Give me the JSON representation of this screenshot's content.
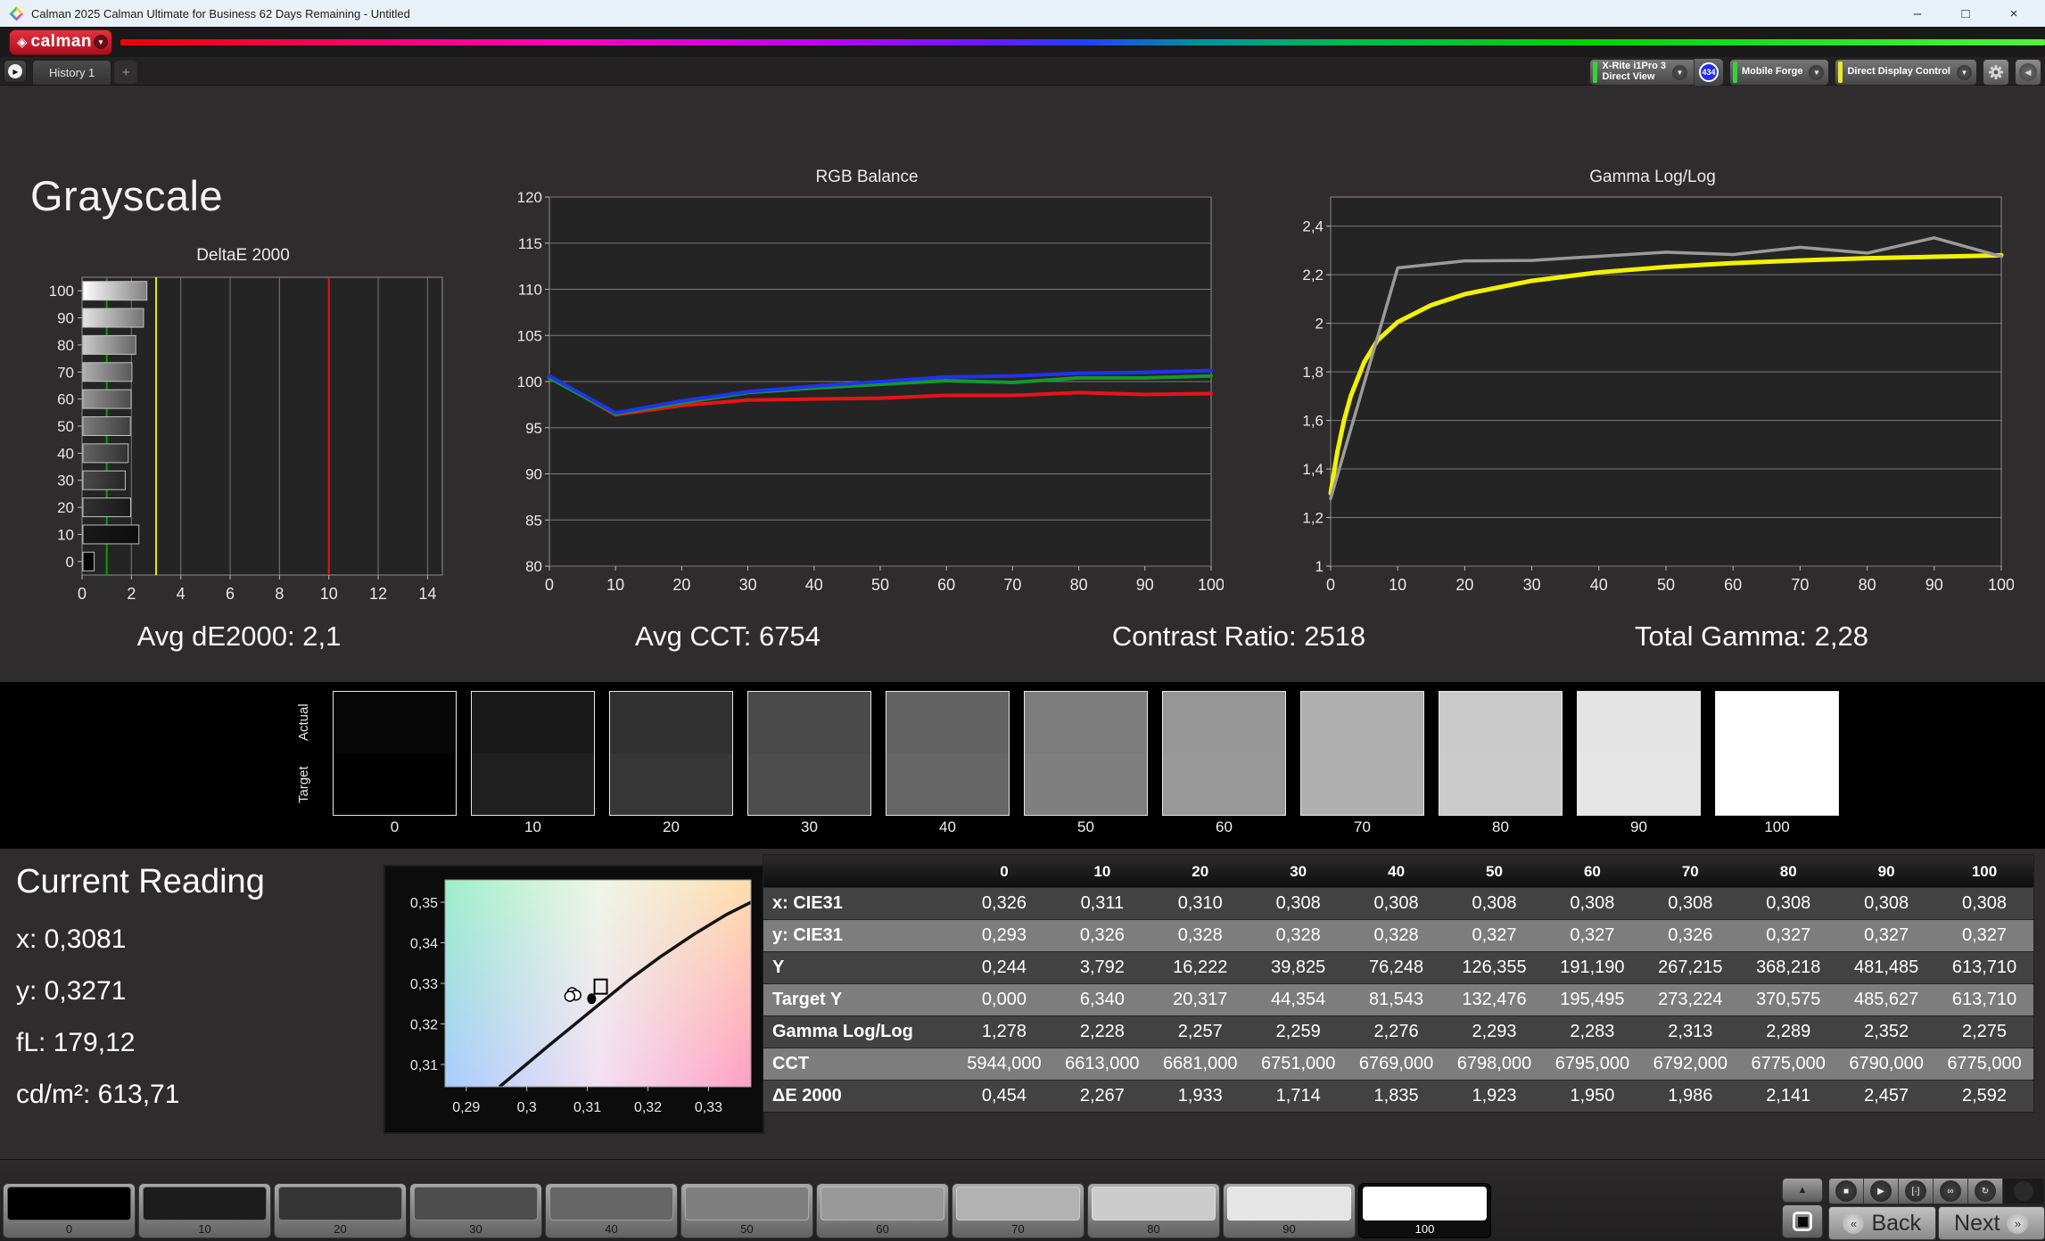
{
  "window": {
    "title": "Calman 2025 Calman Ultimate for Business 62 Days Remaining  - Untitled"
  },
  "icons": {
    "minimize": "–",
    "maximize": "□",
    "close": "×",
    "dropdown_chevron": "▼",
    "panel_arrow": "▶",
    "add_tab": "+",
    "collapse": "◀",
    "brand_diamond": "◈",
    "stop": "■",
    "play": "▶",
    "measure": "[·]",
    "continuous": "∞",
    "refresh": "↻",
    "up": "▲",
    "back_chevron": "«",
    "next_chevron": "»"
  },
  "brand": {
    "name": "calman"
  },
  "tabs": {
    "history": "History 1"
  },
  "meters": {
    "meter1_line1": "X-Rite i1Pro 3",
    "meter1_line2": "Direct View",
    "meter1_badge": "434",
    "meter1_color": "#35d435",
    "meter2_label": "Mobile Forge",
    "meter2_color": "#35d435",
    "meter3_label": "Direct Display Control",
    "meter3_color": "#e8e832"
  },
  "page": {
    "title": "Grayscale"
  },
  "stats": [
    "Avg dE2000: 2,1",
    "Avg CCT: 6754",
    "Contrast Ratio: 2518",
    "Total Gamma: 2,28"
  ],
  "chart_data": [
    {
      "type": "bar",
      "title": "DeltaE 2000",
      "orientation": "horizontal",
      "categories": [
        0,
        10,
        20,
        30,
        40,
        50,
        60,
        70,
        80,
        90,
        100
      ],
      "values": [
        0.454,
        2.267,
        1.933,
        1.714,
        1.835,
        1.923,
        1.95,
        1.986,
        2.141,
        2.457,
        2.592
      ],
      "xlim": [
        0,
        14.6
      ],
      "xticks": [
        0,
        2,
        4,
        6,
        8,
        10,
        12,
        14
      ],
      "ref_lines": [
        {
          "value": 1,
          "color": "#00a400"
        },
        {
          "value": 3,
          "color": "#e8e800"
        },
        {
          "value": 10,
          "color": "#e81313"
        }
      ],
      "bar_colors": [
        "#070707",
        "#191919",
        "#313131",
        "#4a4a4a",
        "#636363",
        "#7c7c7c",
        "#969696",
        "#afafaf",
        "#cacaca",
        "#e4e4e4",
        "#ffffff"
      ],
      "grid": true,
      "legend": "none"
    },
    {
      "type": "line",
      "title": "RGB Balance",
      "x": [
        0,
        10,
        20,
        30,
        40,
        50,
        60,
        70,
        80,
        90,
        100
      ],
      "series": [
        {
          "name": "Red",
          "color": "#e81414",
          "values": [
            100.5,
            96.4,
            97.4,
            98.0,
            98.1,
            98.2,
            98.5,
            98.5,
            98.8,
            98.6,
            98.7
          ]
        },
        {
          "name": "Green",
          "color": "#119a2d",
          "values": [
            100.4,
            96.5,
            97.7,
            98.8,
            99.3,
            99.7,
            100.1,
            99.9,
            100.4,
            100.4,
            100.6
          ]
        },
        {
          "name": "Blue",
          "color": "#2033f0",
          "values": [
            100.6,
            96.6,
            97.9,
            98.9,
            99.5,
            100.0,
            100.5,
            100.6,
            100.9,
            101.0,
            101.2
          ]
        }
      ],
      "ylim": [
        80,
        120
      ],
      "yticks": [
        80,
        85,
        90,
        95,
        100,
        105,
        110,
        115,
        120
      ],
      "ytick_labels": [
        "80",
        "85",
        "90",
        "95",
        "100",
        "105",
        "110",
        "115",
        "120"
      ],
      "xticks": [
        0,
        10,
        20,
        30,
        40,
        50,
        60,
        70,
        80,
        90,
        100
      ],
      "grid": true,
      "legend": "none"
    },
    {
      "type": "line",
      "title": "Gamma Log/Log",
      "x": [
        0,
        10,
        20,
        30,
        40,
        50,
        60,
        70,
        80,
        90,
        100
      ],
      "series": [
        {
          "name": "Target",
          "color": "#f2f200",
          "width": 5,
          "x": [
            0,
            1,
            2,
            3,
            5,
            7,
            10,
            15,
            20,
            30,
            40,
            50,
            60,
            70,
            80,
            90,
            100
          ],
          "values": [
            1.3,
            1.47,
            1.6,
            1.7,
            1.84,
            1.93,
            2.005,
            2.075,
            2.12,
            2.175,
            2.21,
            2.232,
            2.248,
            2.259,
            2.268,
            2.274,
            2.28
          ]
        },
        {
          "name": "Measured",
          "color": "#9a9a9a",
          "width": 3.5,
          "values": [
            1.278,
            2.228,
            2.257,
            2.259,
            2.276,
            2.293,
            2.283,
            2.313,
            2.289,
            2.352,
            2.275
          ]
        }
      ],
      "ylim": [
        1,
        2.52
      ],
      "yticks": [
        1,
        1.2,
        1.4,
        1.6,
        1.8,
        2,
        2.2,
        2.4
      ],
      "ytick_labels": [
        "1",
        "1,2",
        "1,4",
        "1,6",
        "1,8",
        "2",
        "2,2",
        "2,4"
      ],
      "xticks": [
        0,
        10,
        20,
        30,
        40,
        50,
        60,
        70,
        80,
        90,
        100
      ],
      "grid": true,
      "legend": "none"
    },
    {
      "type": "scatter",
      "title": "CIE xy chromaticity detail",
      "xlim": [
        0.2865,
        0.337
      ],
      "ylim": [
        0.3045,
        0.3555
      ],
      "xticks": [
        0.29,
        0.3,
        0.31,
        0.32,
        0.33
      ],
      "xtick_labels": [
        "0,29",
        "0,3",
        "0,31",
        "0,32",
        "0,33"
      ],
      "yticks": [
        0.31,
        0.32,
        0.33,
        0.34,
        0.35
      ],
      "ytick_labels": [
        "0,31",
        "0,32",
        "0,33",
        "0,34",
        "0,35"
      ],
      "locus": [
        [
          0.2955,
          0.3045
        ],
        [
          0.2995,
          0.3095
        ],
        [
          0.3035,
          0.3145
        ],
        [
          0.308,
          0.32
        ],
        [
          0.3125,
          0.3255
        ],
        [
          0.317,
          0.331
        ],
        [
          0.322,
          0.3365
        ],
        [
          0.3275,
          0.342
        ],
        [
          0.333,
          0.347
        ],
        [
          0.337,
          0.35
        ]
      ],
      "measured_points": [
        [
          0.3075,
          0.3277
        ],
        [
          0.3081,
          0.3271
        ],
        [
          0.3071,
          0.3268
        ]
      ],
      "current_point": [
        0.3107,
        0.3262
      ],
      "target_point": [
        0.3122,
        0.3292
      ],
      "corner_colors": {
        "top_left": "#9ff0c9",
        "top_right": "#ffdfae",
        "bottom_left": "#a9ccff",
        "bottom_right": "#ff9fc4"
      }
    }
  ],
  "swatch_strip": {
    "row_labels": [
      "Actual",
      "Target"
    ],
    "levels": [
      "0",
      "10",
      "20",
      "30",
      "40",
      "50",
      "60",
      "70",
      "80",
      "90",
      "100"
    ],
    "actual_colors": [
      "#070707",
      "#191919",
      "#313131",
      "#4a4a4a",
      "#636363",
      "#7c7c7c",
      "#969696",
      "#afafaf",
      "#cacaca",
      "#e4e4e4",
      "#ffffff"
    ],
    "target_colors": [
      "#000000",
      "#202020",
      "#363636",
      "#4d4d4d",
      "#666666",
      "#7f7f7f",
      "#989898",
      "#b0b0b0",
      "#cbcbcb",
      "#e5e5e5",
      "#ffffff"
    ]
  },
  "current_reading": {
    "title": "Current Reading",
    "items": [
      "x: 0,3081",
      "y: 0,3271",
      "fL: 179,12",
      "cd/m²: 613,71"
    ]
  },
  "table": {
    "col_headers": [
      "0",
      "10",
      "20",
      "30",
      "40",
      "50",
      "60",
      "70",
      "80",
      "90",
      "100"
    ],
    "rows": [
      {
        "label": "x: CIE31",
        "values": [
          "0,326",
          "0,311",
          "0,310",
          "0,308",
          "0,308",
          "0,308",
          "0,308",
          "0,308",
          "0,308",
          "0,308",
          "0,308"
        ]
      },
      {
        "label": "y: CIE31",
        "values": [
          "0,293",
          "0,326",
          "0,328",
          "0,328",
          "0,328",
          "0,327",
          "0,327",
          "0,326",
          "0,327",
          "0,327",
          "0,327"
        ]
      },
      {
        "label": "Y",
        "values": [
          "0,244",
          "3,792",
          "16,222",
          "39,825",
          "76,248",
          "126,355",
          "191,190",
          "267,215",
          "368,218",
          "481,485",
          "613,710"
        ]
      },
      {
        "label": "Target Y",
        "values": [
          "0,000",
          "6,340",
          "20,317",
          "44,354",
          "81,543",
          "132,476",
          "195,495",
          "273,224",
          "370,575",
          "485,627",
          "613,710"
        ]
      },
      {
        "label": "Gamma Log/Log",
        "values": [
          "1,278",
          "2,228",
          "2,257",
          "2,259",
          "2,276",
          "2,293",
          "2,283",
          "2,313",
          "2,289",
          "2,352",
          "2,275"
        ]
      },
      {
        "label": "CCT",
        "values": [
          "5944,000",
          "6613,000",
          "6681,000",
          "6751,000",
          "6769,000",
          "6798,000",
          "6795,000",
          "6792,000",
          "6775,000",
          "6790,000",
          "6775,000"
        ]
      },
      {
        "label": "ΔE 2000",
        "values": [
          "0,454",
          "2,267",
          "1,933",
          "1,714",
          "1,835",
          "1,923",
          "1,950",
          "1,986",
          "2,141",
          "2,457",
          "2,592"
        ]
      }
    ]
  },
  "patch_bar": {
    "levels": [
      "0",
      "10",
      "20",
      "30",
      "40",
      "50",
      "60",
      "70",
      "80",
      "90",
      "100"
    ],
    "colors": [
      "#000000",
      "#1c1c1c",
      "#343434",
      "#4d4d4d",
      "#666666",
      "#7f7f7f",
      "#999999",
      "#b2b2b2",
      "#cccccc",
      "#e5e5e5",
      "#ffffff"
    ],
    "selected": "100"
  },
  "transport": {
    "back": "Back",
    "next": "Next"
  }
}
